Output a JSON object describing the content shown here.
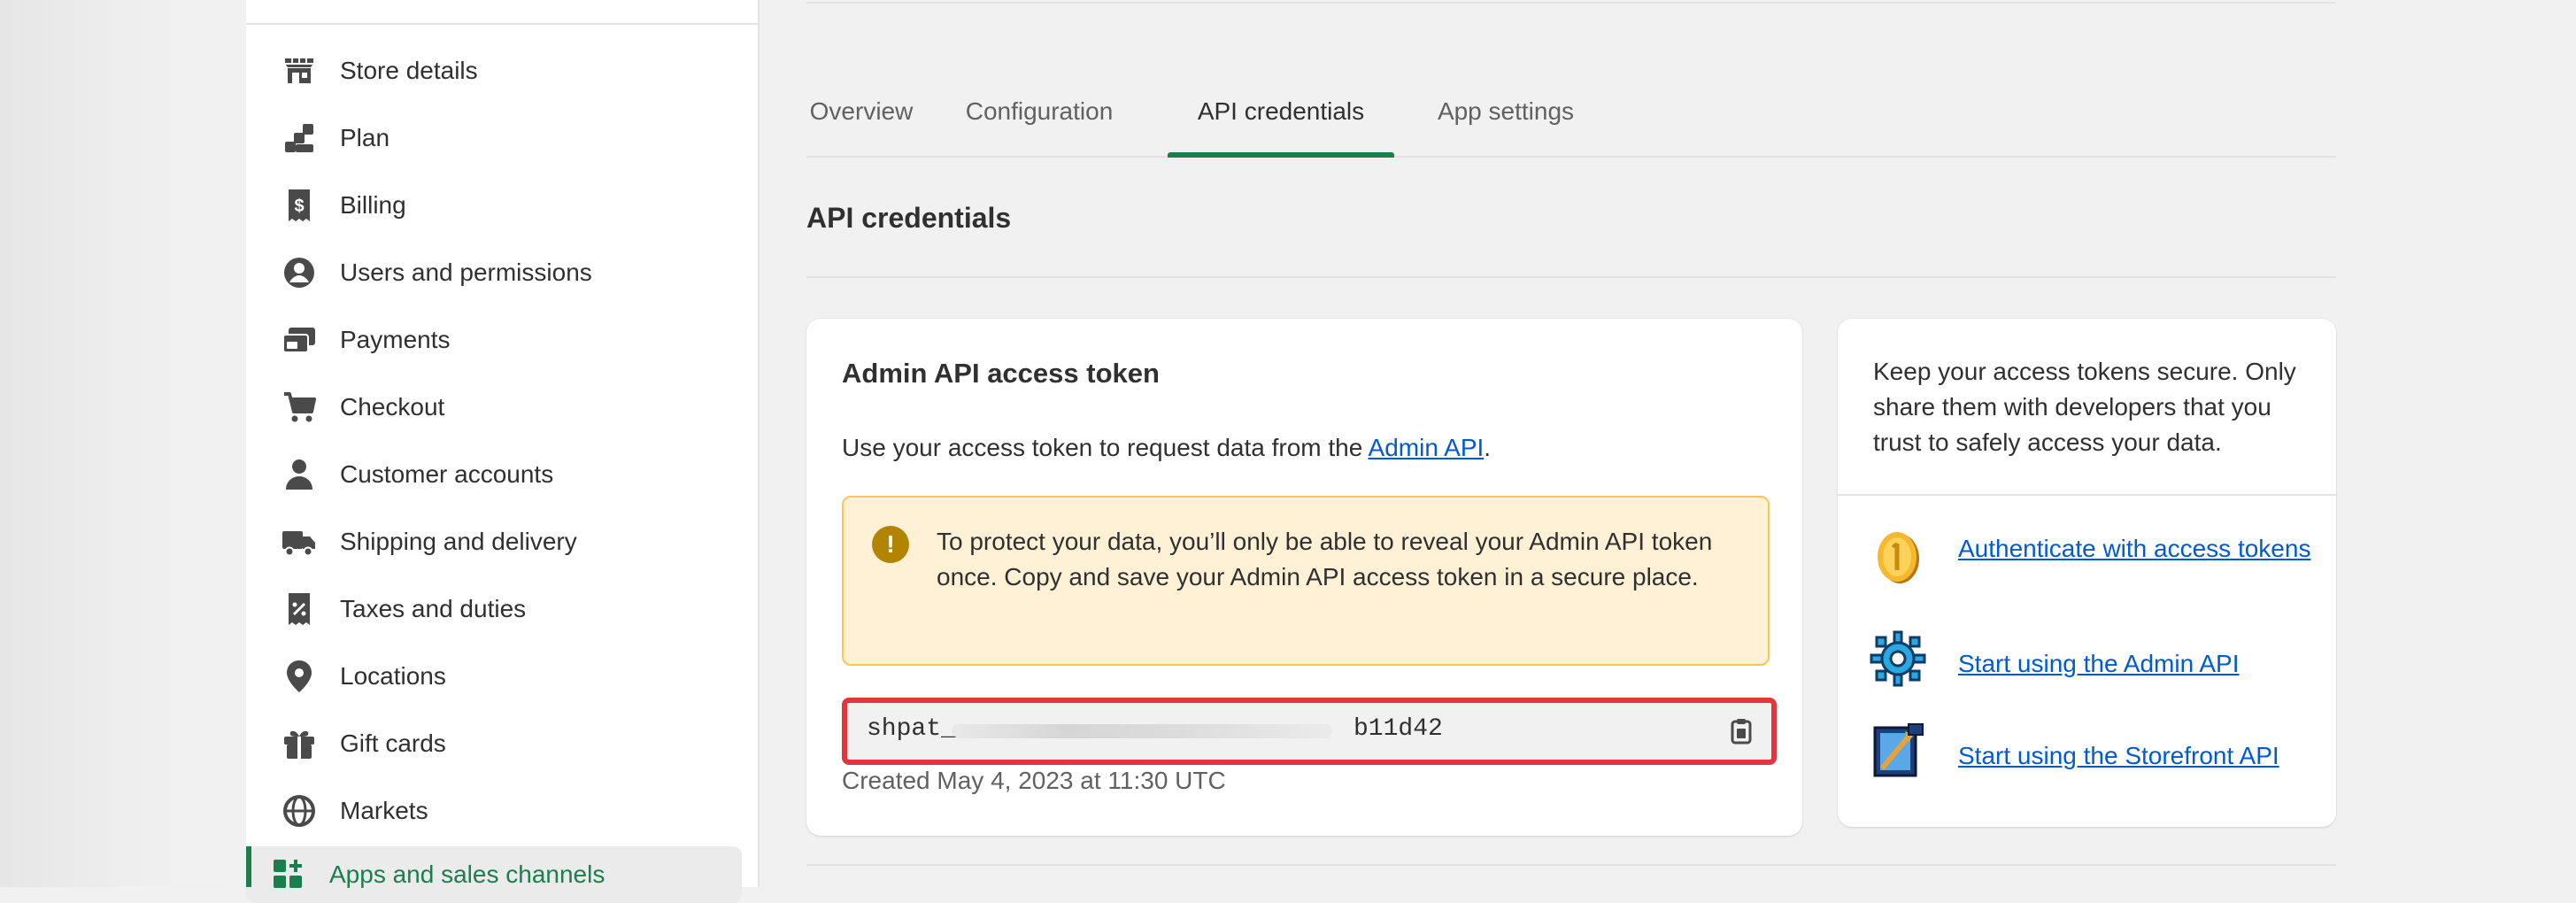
{
  "sidebar": {
    "items": [
      {
        "label": "Store details",
        "icon": "store-icon"
      },
      {
        "label": "Plan",
        "icon": "plan-icon"
      },
      {
        "label": "Billing",
        "icon": "billing-icon"
      },
      {
        "label": "Users and permissions",
        "icon": "user-circle-icon"
      },
      {
        "label": "Payments",
        "icon": "payments-icon"
      },
      {
        "label": "Checkout",
        "icon": "cart-icon"
      },
      {
        "label": "Customer accounts",
        "icon": "person-icon"
      },
      {
        "label": "Shipping and delivery",
        "icon": "truck-icon"
      },
      {
        "label": "Taxes and duties",
        "icon": "tax-receipt-icon"
      },
      {
        "label": "Locations",
        "icon": "location-pin-icon"
      },
      {
        "label": "Gift cards",
        "icon": "gift-icon"
      },
      {
        "label": "Markets",
        "icon": "globe-icon"
      },
      {
        "label": "Apps and sales channels",
        "icon": "apps-icon",
        "active": true
      }
    ]
  },
  "tabs": [
    {
      "label": "Overview"
    },
    {
      "label": "Configuration"
    },
    {
      "label": "API credentials",
      "active": true
    },
    {
      "label": "App settings"
    }
  ],
  "section_title": "API credentials",
  "token_card": {
    "title": "Admin API access token",
    "desc_prefix": "Use your access token to request data from the ",
    "desc_link": "Admin API",
    "desc_suffix": ".",
    "banner_text": "To protect your data, you’ll only be able to reveal your Admin API token once. Copy and save your Admin API access token in a secure place.",
    "token_prefix": "shpat_",
    "token_suffix": "b11d42",
    "created": "Created May 4, 2023 at 11:30 UTC"
  },
  "info_card": {
    "text": "Keep your access tokens secure. Only share them with developers that you trust to safely access your data.",
    "links": [
      {
        "label": "Authenticate with access tokens",
        "icon": "coin-icon"
      },
      {
        "label": "Start using the Admin API",
        "icon": "gear-icon"
      },
      {
        "label": "Start using the Storefront API",
        "icon": "storefront-tool-icon"
      }
    ]
  },
  "colors": {
    "accent": "#1a7f4d",
    "link": "#005bd3",
    "warning_bg": "#fff1d6",
    "warning_border": "#ffc453",
    "highlight": "#e3353d"
  }
}
